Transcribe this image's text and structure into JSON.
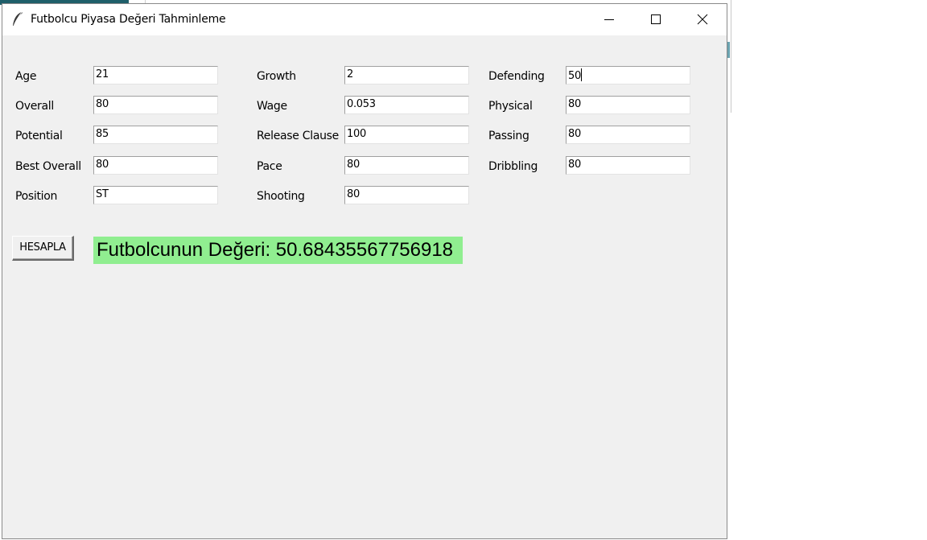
{
  "window": {
    "title": "Futbolcu Piyasa Değeri Tahminleme",
    "icon": "feather-icon"
  },
  "form": {
    "fields": [
      {
        "label": "Age",
        "value": "21"
      },
      {
        "label": "Overall",
        "value": "80"
      },
      {
        "label": "Potential",
        "value": "85"
      },
      {
        "label": "Best Overall",
        "value": "80"
      },
      {
        "label": "Position",
        "value": "ST"
      },
      {
        "label": "Growth",
        "value": "2"
      },
      {
        "label": "Wage",
        "value": "0.053"
      },
      {
        "label": "Release Clause",
        "value": "100"
      },
      {
        "label": "Pace",
        "value": "80"
      },
      {
        "label": "Shooting",
        "value": "80"
      },
      {
        "label": "Defending",
        "value": "50"
      },
      {
        "label": "Physical",
        "value": "80"
      },
      {
        "label": "Passing",
        "value": "80"
      },
      {
        "label": "Dribbling",
        "value": "80"
      }
    ]
  },
  "actions": {
    "calculate_label": "HESAPLA"
  },
  "result": {
    "text": "Futbolcunun Değeri: 50.68435567756918",
    "bg_color": "#90ee90"
  }
}
